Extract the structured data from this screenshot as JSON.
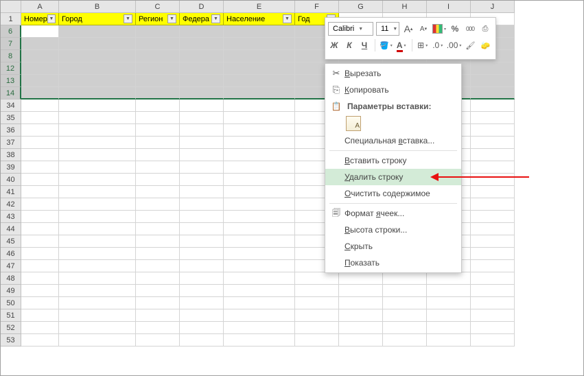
{
  "columns": [
    "A",
    "B",
    "C",
    "D",
    "E",
    "F",
    "G",
    "H",
    "I",
    "J"
  ],
  "headers": {
    "A": "Номер",
    "B": "Город",
    "C": "Регион",
    "D": "Федера",
    "E": "Население",
    "F": "Год"
  },
  "selected_rows": [
    "6",
    "7",
    "8",
    "12",
    "13",
    "14"
  ],
  "body_rows_after": [
    "34",
    "35",
    "36",
    "37",
    "38",
    "39",
    "40",
    "41",
    "42",
    "43",
    "44",
    "45",
    "46",
    "47",
    "48",
    "49",
    "50",
    "51",
    "52",
    "53"
  ],
  "mini_toolbar": {
    "font_name": "Calibri",
    "font_size": "11",
    "bold": "Ж",
    "italic": "К"
  },
  "context_menu": {
    "cut": "Вырезать",
    "copy": "Копировать",
    "paste_opts_title": "Параметры вставки:",
    "paste_special": "Специальная вставка...",
    "insert_row": "Вставить строку",
    "delete_row": "Удалить строку",
    "clear": "Очистить содержимое",
    "format_cells": "Формат ячеек...",
    "row_height": "Высота строки...",
    "hide": "Скрыть",
    "show": "Показать"
  },
  "accel": {
    "cut": "В",
    "copy": "К",
    "paste_special": "в",
    "insert_row": "В",
    "delete_row": "У",
    "clear": "О",
    "format_cells": "я",
    "row_height": "В",
    "hide": "С",
    "show": "П"
  }
}
